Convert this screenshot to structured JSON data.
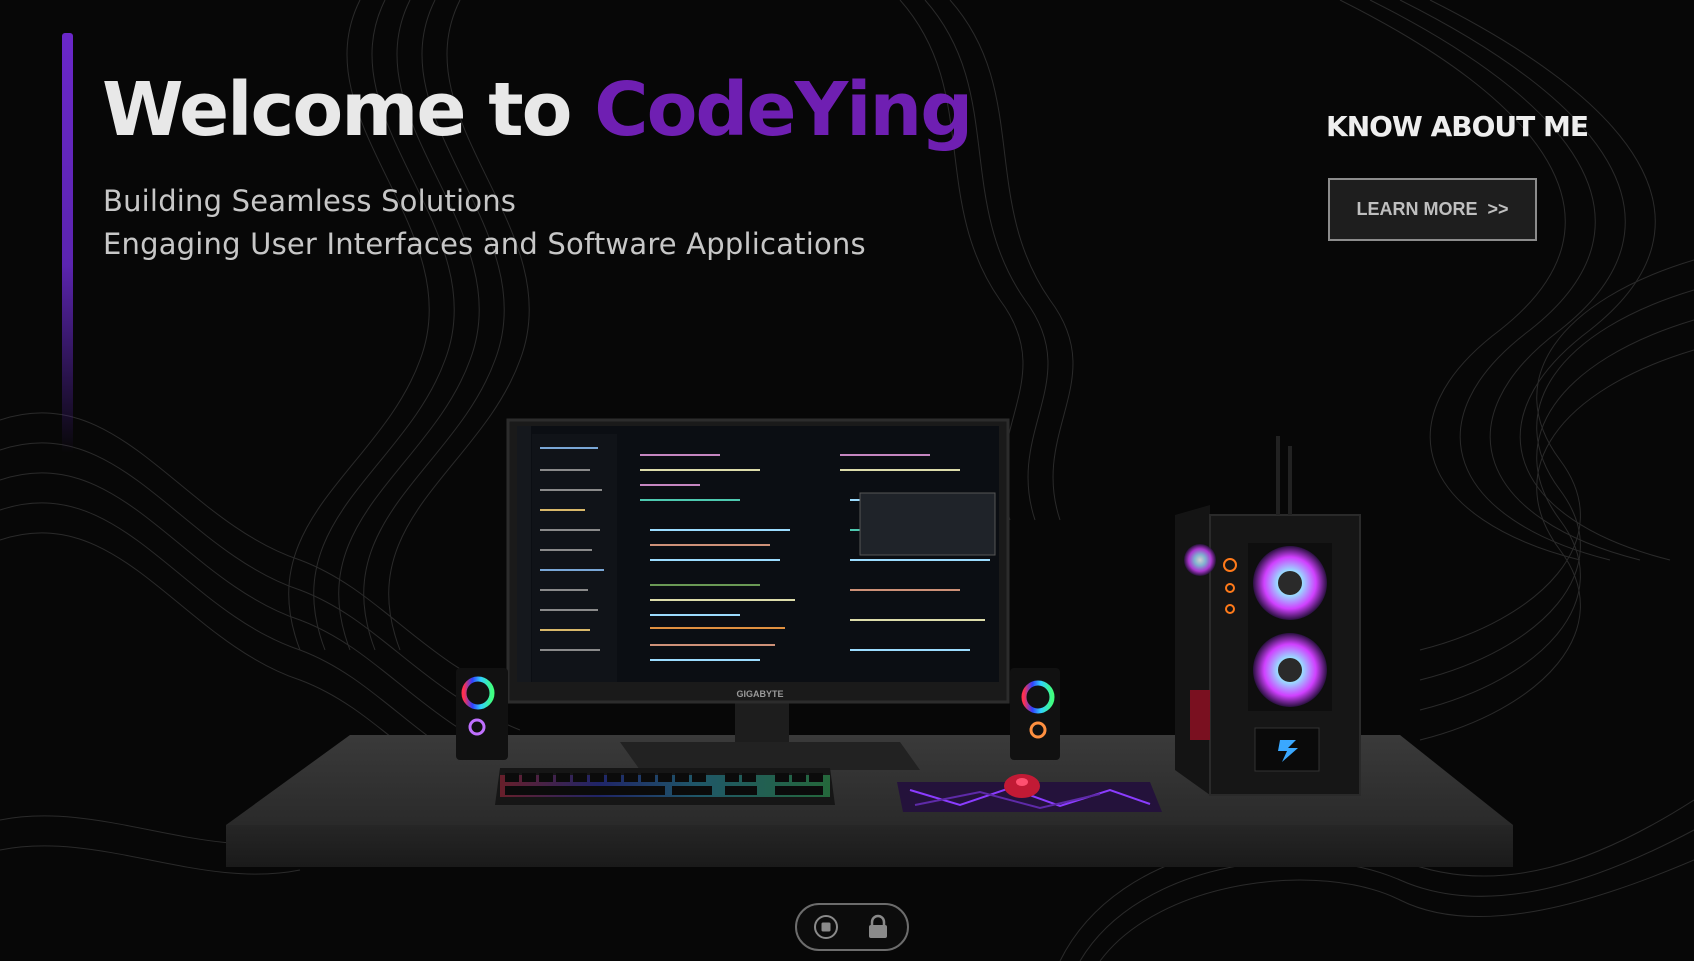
{
  "hero": {
    "title_lead": "Welcome to ",
    "title_brand": "CodeYing",
    "subtitle_line1": "Building Seamless Solutions",
    "subtitle_line2": "Engaging User Interfaces and Software Applications"
  },
  "about": {
    "heading": "KNOW ABOUT ME",
    "button_label": "LEARN MORE",
    "button_arrow": ">>"
  },
  "scene": {
    "monitor_brand": "GIGABYTE"
  },
  "controls": {
    "items": [
      {
        "icon": "stop-icon"
      },
      {
        "icon": "lock-icon"
      }
    ]
  },
  "colors": {
    "background": "#070707",
    "brand_purple": "#6f1fb2",
    "accent_bar": "#6a27c9",
    "text_light": "#e8e8e8"
  }
}
